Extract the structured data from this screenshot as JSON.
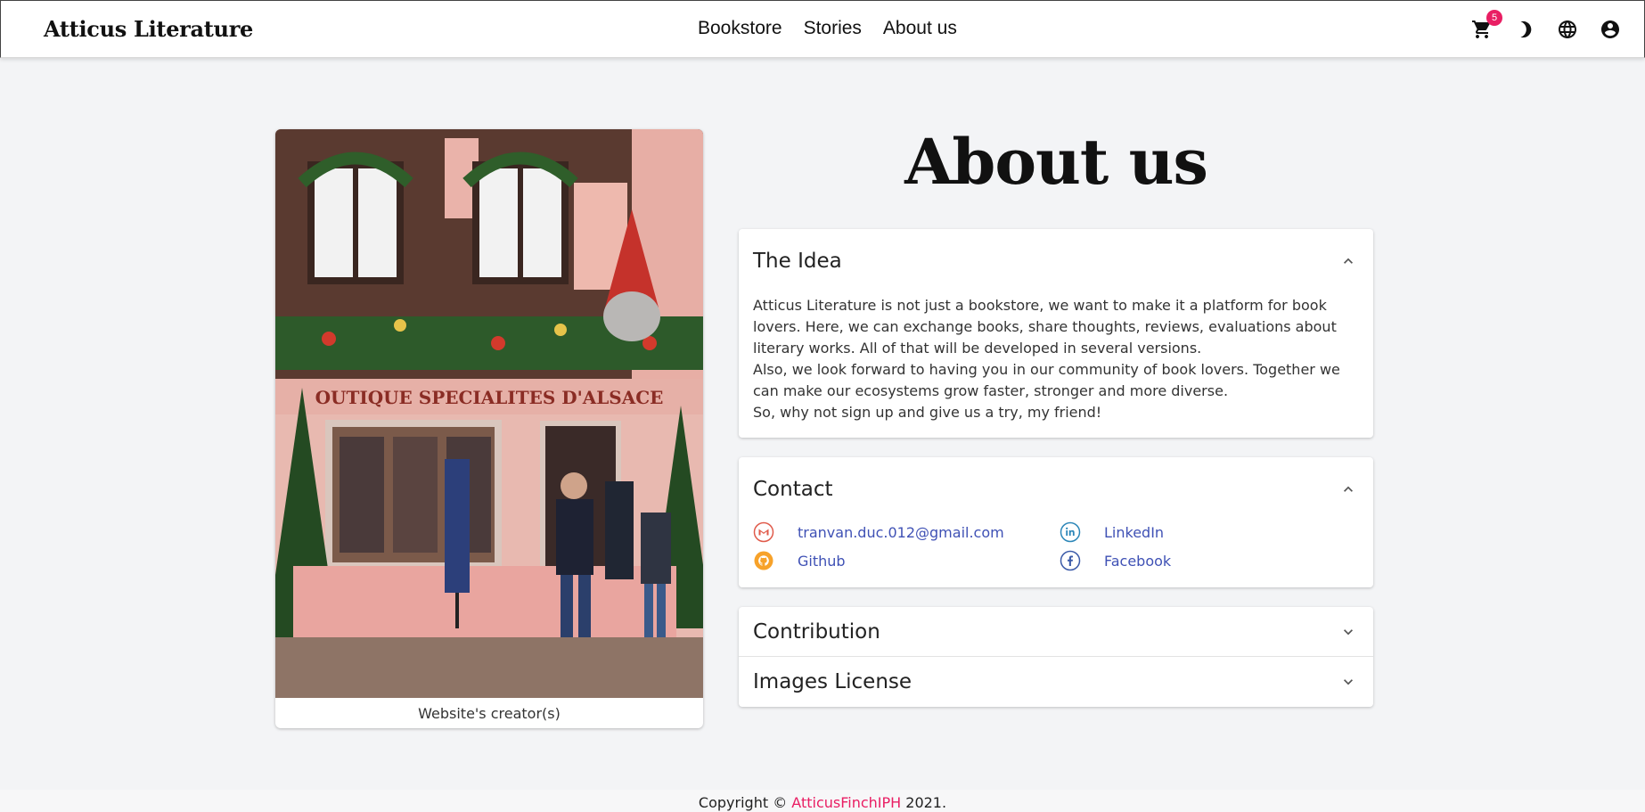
{
  "header": {
    "brand": "Atticus Literature",
    "nav": [
      "Bookstore",
      "Stories",
      "About us"
    ],
    "cart_count": "5",
    "icons": [
      "cart-icon",
      "dark-mode-icon",
      "language-icon",
      "account-icon"
    ]
  },
  "photo": {
    "caption": "Website's creator(s)",
    "sign_text": "OUTIQUE SPECIALITES D'ALSACE"
  },
  "page": {
    "title": "About us"
  },
  "sections": {
    "idea": {
      "title": "The Idea",
      "paragraphs": [
        "Atticus Literature is not just a bookstore, we want to make it a platform for book lovers. Here, we can exchange books, share thoughts, reviews, evaluations about literary works. All of that will be developed in several versions.",
        "Also, we look forward to having you in our community of book lovers. Together we can make our ecosystems grow faster, stronger and more diverse.",
        "So, why not sign up and give us a try, my friend!"
      ]
    },
    "contact": {
      "title": "Contact",
      "email": "tranvan.duc.012@gmail.com",
      "linkedin": "LinkedIn",
      "github": "Github",
      "facebook": "Facebook"
    },
    "contribution": {
      "title": "Contribution"
    },
    "license": {
      "title": "Images License"
    }
  },
  "footer": {
    "prefix": "Copyright ©",
    "author": "AtticusFinchIPH",
    "year": "2021."
  },
  "colors": {
    "accent": "#e91e63",
    "link": "#3f51b5",
    "background": "#f3f4f6"
  }
}
